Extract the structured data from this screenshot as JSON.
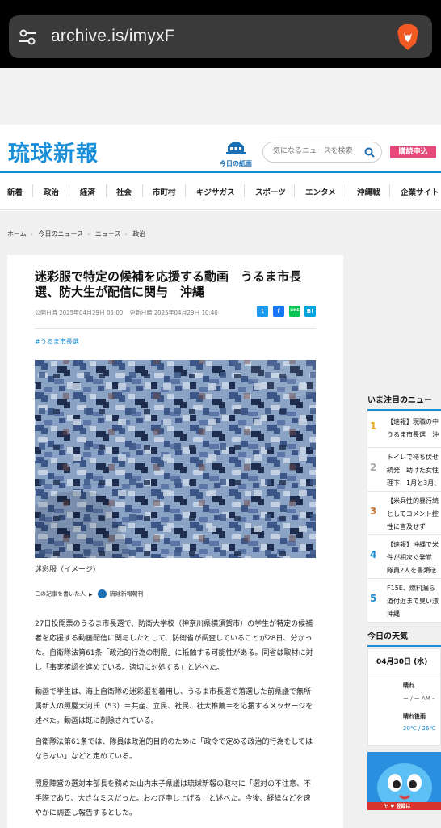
{
  "browser": {
    "url": "archive.is/imyxF",
    "tune_icon": "tune-icon",
    "brave_icon": "brave-lion-icon"
  },
  "site": {
    "logo": "琉球新報",
    "today_paper": "今日の紙面",
    "search_placeholder": "気になるニュースを検索",
    "subscribe": "購読申込"
  },
  "nav": [
    "新着",
    "政治",
    "経済",
    "社会",
    "市町村",
    "キジサガス",
    "スポーツ",
    "エンタメ",
    "沖縄戦",
    "企業サイト"
  ],
  "breadcrumb": [
    "ホーム",
    "今日のニュース",
    "ニュース",
    "政治"
  ],
  "article": {
    "headline": "迷彩服で特定の候補を応援する動画　うるま市長選、防大生が配信に関与　沖縄",
    "published": "公開日時 2025年04月29日 05:00",
    "updated": "更新日時 2025年04月29日 10:40",
    "share": {
      "twitter": "t",
      "facebook": "f",
      "line": "LINE",
      "hatena": "B!"
    },
    "tag": "#うるま市長選",
    "caption": "迷彩服（イメージ）",
    "author_label": "この記事を書いた人",
    "author_name": "琉球新報朝刊",
    "paragraphs": [
      "27日投開票のうるま市長選で、防衛大学校（神奈川県横須賀市）の学生が特定の候補者を応援する動画配信に関与したとして、防衛省が調査していることが28日、分かった。自衛隊法第61条「政治的行為の制限」に抵触する可能性がある。同省は取材に対し「事実確認を進めている。適切に対処する」と述べた。",
      "動画で学生は、海上自衛隊の迷彩服を着用し、うるま市長選で落選した前県議で無所属新人の照屋大河氏（53）＝共産、立民、社民、社大推薦＝を応援するメッセージを述べた。動画は既に削除されている。",
      "自衛隊法第61条では、隊員は政治的目的のために「政令で定める政治的行為をしてはならない」などと定めている。",
      "照屋陣営の選対本部長を務めた山内末子県議は琉球新報の取材に「選対の不注意、不手際であり、大きなミスだった。おわび申し上げる」と述べた。今後、経緯などを速やかに調査し報告するとした。"
    ]
  },
  "sidebar": {
    "title": "いま注目のニュー",
    "ranking": [
      {
        "num": "1",
        "color": "#e0a81a",
        "lines": [
          "【速報】現職の中",
          "うるま市長選　沖"
        ]
      },
      {
        "num": "2",
        "color": "#a8a8a8",
        "lines": [
          "トイレで待ち伏せ",
          "続発　助けた女性",
          "理下　1月と3月、"
        ]
      },
      {
        "num": "3",
        "color": "#c77a3a",
        "lines": [
          "【米兵性的暴行続",
          "としてコメント控",
          "性に言及せず"
        ]
      },
      {
        "num": "4",
        "color": "#1a8fd7",
        "lines": [
          "【速報】沖縄で米",
          "件が相次ぐ発覚",
          "隊員2人を書類送"
        ]
      },
      {
        "num": "5",
        "color": "#1a8fd7",
        "lines": [
          "F15E、燃料漏ら",
          "道付近まで臭い漂",
          "沖縄"
        ]
      }
    ],
    "weather_title": "今日の天気",
    "weather": {
      "date": "04月30日 (水)",
      "am_label": "晴れ",
      "am_sub": "ー / ー  AM -",
      "pm_label": "晴れ後雨",
      "pm_temp": "20℃ / 26℃"
    },
    "banner_text": "ヤ ♥ 登録は"
  }
}
